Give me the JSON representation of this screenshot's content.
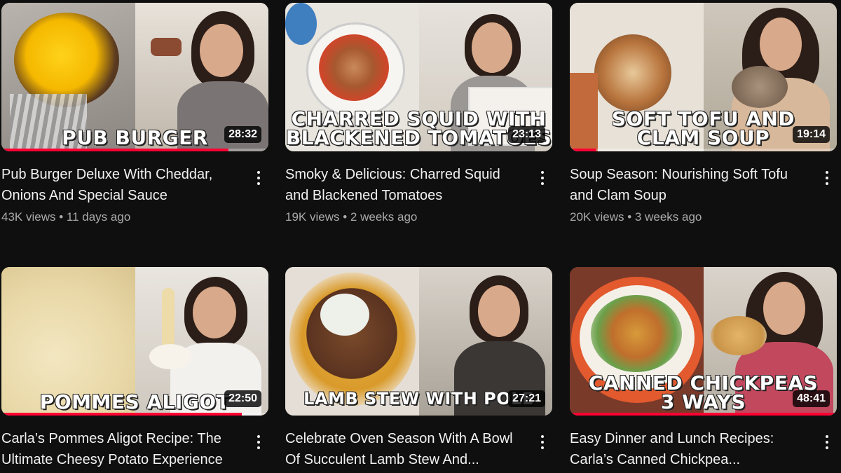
{
  "videos": [
    {
      "overlay": "PUB BURGER",
      "duration": "28:32",
      "progress_fraction": 0.85,
      "title": "Pub Burger Deluxe With Cheddar,\nOnions And Special Sauce",
      "views": "43K views",
      "age": "11 days ago"
    },
    {
      "overlay": "CHARRED SQUID WITH\nBLACKENED TOMATOES",
      "duration": "23:13",
      "progress_fraction": 0,
      "title": "Smoky & Delicious: Charred Squid\nand Blackened Tomatoes",
      "views": "19K views",
      "age": "2 weeks ago"
    },
    {
      "overlay": "SOFT TOFU AND\nCLAM SOUP",
      "duration": "19:14",
      "progress_fraction": 0.1,
      "title": "Soup Season: Nourishing Soft Tofu\nand Clam Soup",
      "views": "20K views",
      "age": "3 weeks ago"
    },
    {
      "overlay": "POMMES ALIGOT",
      "duration": "22:50",
      "progress_fraction": 0.9,
      "title": "Carla’s Pommes Aligot Recipe: The\nUltimate Cheesy Potato Experience",
      "views": "",
      "age": ""
    },
    {
      "overlay": "LAMB STEW WITH POLE",
      "duration": "27:21",
      "progress_fraction": 0,
      "title": "Celebrate Oven Season With A Bowl\nOf Succulent Lamb Stew And...",
      "views": "",
      "age": ""
    },
    {
      "overlay": "CANNED CHICKPEAS\n3 WAYS",
      "duration": "48:41",
      "progress_fraction": 1,
      "title": "Easy Dinner and Lunch Recipes:\nCarla’s Canned Chickpea...",
      "views": "",
      "age": ""
    }
  ],
  "colors": {
    "background": "#0f0f0f",
    "progress": "#ff0033",
    "meta_text": "#aaaaaa"
  },
  "icons": {
    "more": "more-vertical-icon"
  }
}
